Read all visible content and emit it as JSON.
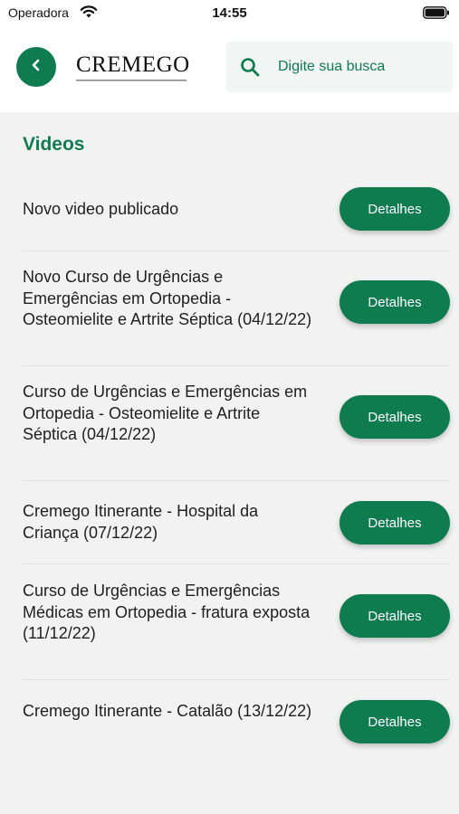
{
  "status_bar": {
    "carrier": "Operadora",
    "time": "14:55"
  },
  "header": {
    "logo_text": "CREMEGO",
    "search": {
      "placeholder": "Digite sua busca"
    }
  },
  "page": {
    "section_title": "Videos"
  },
  "videos": [
    {
      "title": "Novo video publicado",
      "button_label": "Detalhes"
    },
    {
      "title": "Novo Curso de Urgências e Emergências em Ortopedia - Osteomielite e Artrite Séptica (04/12/22)",
      "button_label": "Detalhes"
    },
    {
      "title": "Curso de Urgências e Emergências em Ortopedia - Osteomielite e Artrite Séptica (04/12/22)",
      "button_label": "Detalhes"
    },
    {
      "title": "Cremego Itinerante - Hospital da Criança (07/12/22)",
      "button_label": "Detalhes"
    },
    {
      "title": "Curso de Urgências e Emergências Médicas em Ortopedia - fratura exposta (11/12/22)",
      "button_label": "Detalhes"
    },
    {
      "title": "Cremego Itinerante - Catalão (13/12/22)",
      "button_label": "Detalhes"
    }
  ],
  "colors": {
    "brand_green": "#0f7c50",
    "background": "#f2f2f2",
    "header_background": "#ffffff",
    "search_background": "#f1f5f3"
  },
  "icons": {
    "wifi": "wifi-icon",
    "battery": "battery-icon",
    "back": "chevron-left-icon",
    "search": "search-icon"
  }
}
